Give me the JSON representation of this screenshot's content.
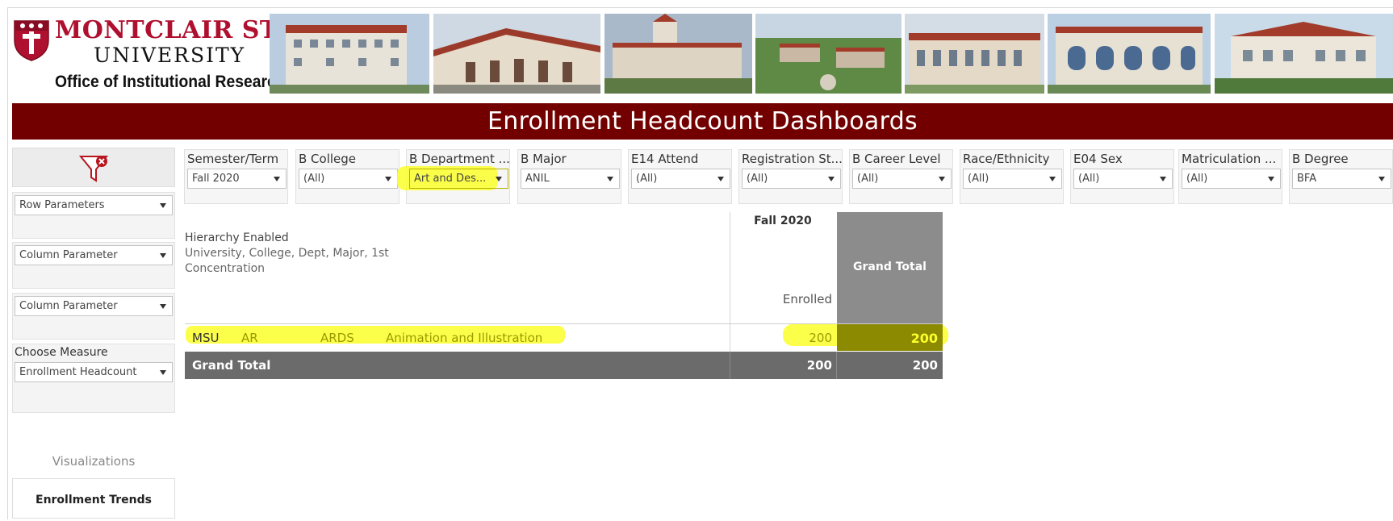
{
  "header": {
    "logo_line1": "MONTCLAIR STATE",
    "logo_line2": "UNIVERSITY",
    "logo_line3": "Office of Institutional Research",
    "title": "Enrollment Headcount Dashboards"
  },
  "colors": {
    "banner": "#730000",
    "brand_red": "#b0102f",
    "highlight": "#fbff2a",
    "grand_total": "#8c8c8c"
  },
  "sidebar": {
    "clear_filter_icon": "clear-filter-icon",
    "row_parameter": "Row Parameters",
    "column_parameter_1": "Column Parameter",
    "column_parameter_2": "Column Parameter",
    "choose_measure_label": "Choose Measure",
    "choose_measure_value": "Enrollment Headcount",
    "visualizations_label": "Visualizations",
    "enrollment_trends": "Enrollment Trends"
  },
  "filters": [
    {
      "label": "Semester/Term",
      "value": "Fall 2020"
    },
    {
      "label": "B College",
      "value": "(All)"
    },
    {
      "label": "B Department ...",
      "value": "Art and Des..."
    },
    {
      "label": "B Major",
      "value": "ANIL"
    },
    {
      "label": "E14 Attend",
      "value": "(All)"
    },
    {
      "label": "Registration St...",
      "value": "(All)"
    },
    {
      "label": "B Career Level",
      "value": "(All)"
    },
    {
      "label": "Race/Ethnicity",
      "value": "(All)"
    },
    {
      "label": "E04 Sex",
      "value": "(All)"
    },
    {
      "label": "Matriculation ...",
      "value": "(All)"
    },
    {
      "label": "B Degree",
      "value": "BFA"
    }
  ],
  "table": {
    "hierarchy_label": "Hierarchy Enabled",
    "hierarchy_desc_1": "University, College, Dept, Major, 1st",
    "hierarchy_desc_2": "Concentration",
    "col_term": "Fall 2020",
    "col_measure": "Enrolled",
    "col_grand_total": "Grand Total",
    "row": {
      "university": "MSU",
      "college": "AR",
      "department": "ARDS",
      "major": "Animation and Illustration",
      "enrolled": "200",
      "grand_total": "200"
    },
    "grand_total_row": {
      "label": "Grand Total",
      "enrolled": "200",
      "grand_total": "200"
    }
  }
}
